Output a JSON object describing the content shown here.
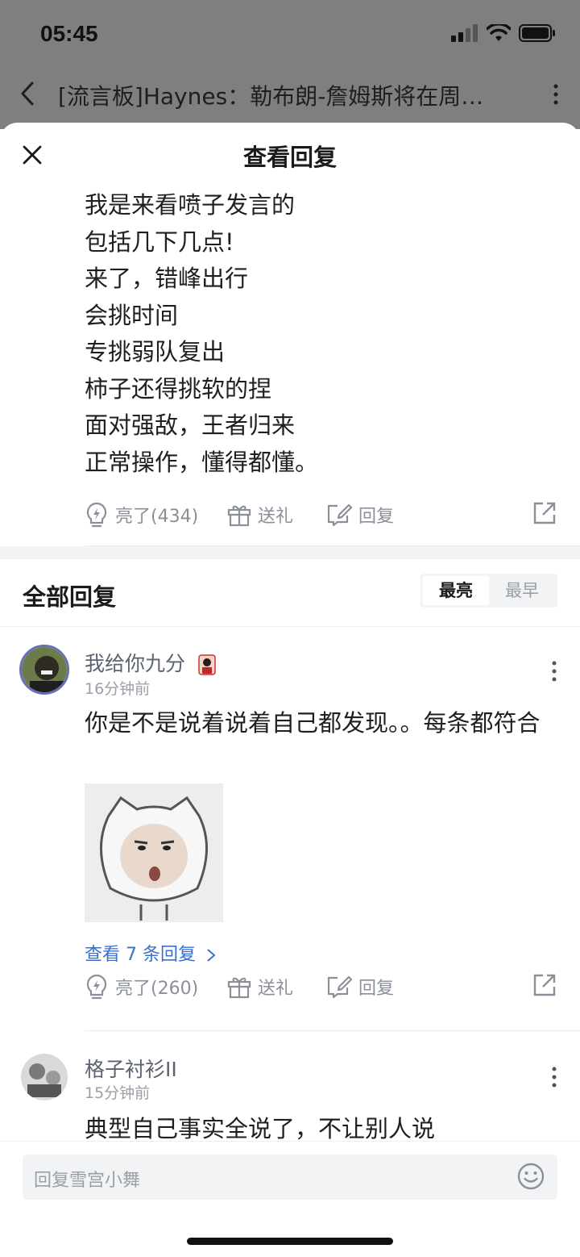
{
  "status_bar": {
    "time": "05:45"
  },
  "background_nav": {
    "title": "[流言板]Haynes：勒布朗-詹姆斯将在周…"
  },
  "sheet": {
    "title": "查看回复"
  },
  "main_post": {
    "lines": [
      "我是来看喷子发言的",
      "包括几下几点!",
      "来了，错峰出行",
      "会挑时间",
      "专挑弱队复出",
      "柿子还得挑软的捏",
      "面对强敌，王者归来",
      "正常操作，懂得都懂。"
    ],
    "actions": {
      "light": "亮了(434)",
      "gift": "送礼",
      "reply": "回复"
    }
  },
  "all_replies": {
    "title": "全部回复",
    "sort_options": [
      "最亮",
      "最早"
    ],
    "active_sort": "最亮"
  },
  "replies": [
    {
      "name": "我给你九分",
      "time": "16分钟前",
      "text": "你是不是说着说着自己都发现。。每条都符合",
      "view_more": "查看 7 条回复",
      "actions": {
        "light": "亮了(260)",
        "gift": "送礼",
        "reply": "回复"
      }
    },
    {
      "name": "格子衬衫II",
      "time": "15分钟前",
      "text": "典型自己事实全说了，不让别人说"
    }
  ],
  "reply_bar": {
    "placeholder": "回复雪宫小舞"
  },
  "colors": {
    "link_blue": "#3a6fd0",
    "muted_gray": "#8a8f99"
  }
}
